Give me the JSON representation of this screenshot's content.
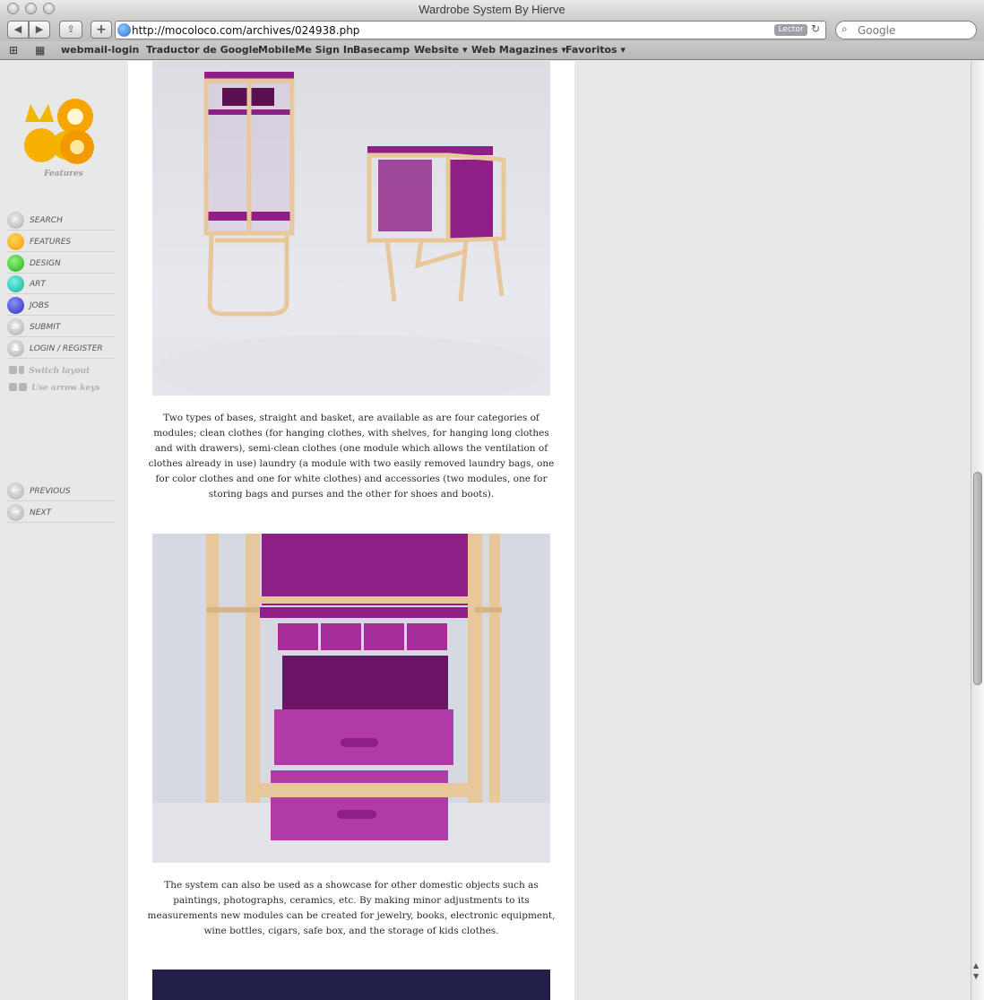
{
  "window": {
    "title": "Wardrobe System By Hierve"
  },
  "toolbar": {
    "back": "◀",
    "forward": "▶",
    "bookmark_btn": "⇪",
    "add": "+",
    "url": "http://mocoloco.com/archives/024938.php",
    "reader_label": "Lector",
    "reload": "↻",
    "search_placeholder": "Google"
  },
  "bookmarks": {
    "items": [
      "webmail-login",
      "Traductor de Google",
      "MobileMe Sign In",
      "Basecamp",
      "Website ▾",
      "Web Magazines ▾",
      "Favoritos ▾"
    ]
  },
  "sidebar": {
    "logo_caption": "Features",
    "nav": [
      {
        "label": "SEARCH",
        "color": "gray",
        "icon": "search-icon"
      },
      {
        "label": "FEATURES",
        "color": "#f5a400"
      },
      {
        "label": "DESIGN",
        "color": "#2fc21f"
      },
      {
        "label": "ART",
        "color": "#12c9b2"
      },
      {
        "label": "JOBS",
        "color": "#3c3fd0"
      },
      {
        "label": "SUBMIT",
        "color": "gray",
        "icon": "list-icon"
      },
      {
        "label": "LOGIN / REGISTER",
        "color": "gray",
        "icon": "user-icon"
      }
    ],
    "hints": [
      "Switch layout",
      "Use arrow keys"
    ],
    "pager": [
      {
        "label": "PREVIOUS",
        "icon": "arrow-left-icon"
      },
      {
        "label": "NEXT",
        "icon": "arrow-right-icon"
      }
    ]
  },
  "article": {
    "caption1": "Two types of bases, straight and basket, are available as are four categories of modules; clean clothes (for hanging clothes, with shelves, for hanging long clothes and with drawers), semi-clean clothes (one module which allows the ventilation of clothes already in use) laundry (a module with two easily removed laundry bags, one for color clothes and one for white clothes) and accessories (two modules, one for storing bags and purses and the other for shoes and boots).",
    "caption2": "The system can also be used as a showcase for other domestic objects such as paintings, photographs, ceramics, etc. By making minor adjustments to its measurements new modules can be created for jewelry, books, electronic equipment, wine bottles, cigars, safe box, and the storage of kids clothes."
  },
  "colors": {
    "accent_purple": "#8e1f86",
    "wood": "#e8c79a"
  }
}
